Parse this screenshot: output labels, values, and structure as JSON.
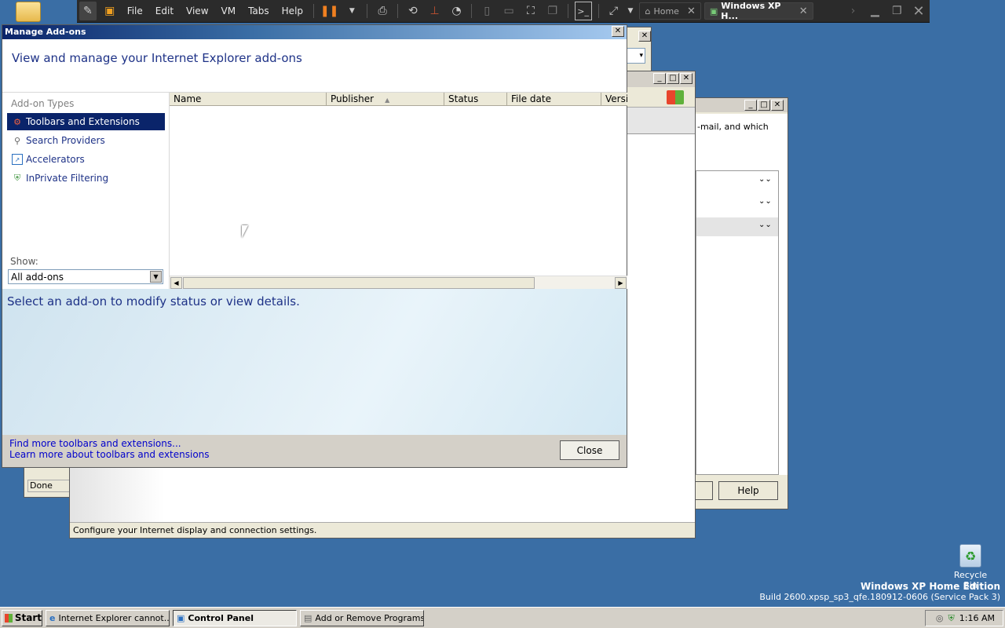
{
  "vm_toolbar": {
    "menus": [
      "File",
      "Edit",
      "View",
      "VM",
      "Tabs",
      "Help"
    ],
    "tabs": [
      {
        "label": "Home",
        "active": false
      },
      {
        "label": "Windows XP H...",
        "active": true
      }
    ]
  },
  "dialog": {
    "title": "Manage Add-ons",
    "heading": "View and manage your Internet Explorer add-ons",
    "types_label": "Add-on Types",
    "types": [
      {
        "label": "Toolbars and Extensions",
        "icon": "gear-icon",
        "selected": true
      },
      {
        "label": "Search Providers",
        "icon": "magnifier-icon",
        "selected": false
      },
      {
        "label": "Accelerators",
        "icon": "accelerator-icon",
        "selected": false
      },
      {
        "label": "InPrivate Filtering",
        "icon": "inprivate-icon",
        "selected": false
      }
    ],
    "show_label": "Show:",
    "show_value": "All add-ons",
    "columns": [
      "Name",
      "Publisher",
      "Status",
      "File date",
      "Versi"
    ],
    "details_text": "Select an add-on to modify status or view details.",
    "link_find": "Find more toolbars and extensions...",
    "link_learn": "Learn more about toolbars and extensions",
    "close_label": "Close"
  },
  "background": {
    "status_done": "Done",
    "internet_options_status": "Configure your Internet display and connection settings.",
    "control_panel_text": "-mail, and which",
    "help_button": "Help"
  },
  "desktop": {
    "recycle_bin": "Recycle Bin",
    "edition": "Windows XP Home Edition",
    "build": "Build 2600.xpsp_sp3_qfe.180912-0606 (Service Pack 3)"
  },
  "taskbar": {
    "start": "Start",
    "tasks": [
      {
        "label": "Internet Explorer cannot...",
        "active": false
      },
      {
        "label": "Control Panel",
        "active": true
      },
      {
        "label": "Add or Remove Programs",
        "active": false
      }
    ],
    "clock": "1:16 AM"
  },
  "colors": {
    "desktop": "#3a6ea5",
    "selection": "#0a246a",
    "link": "#0000cc"
  }
}
